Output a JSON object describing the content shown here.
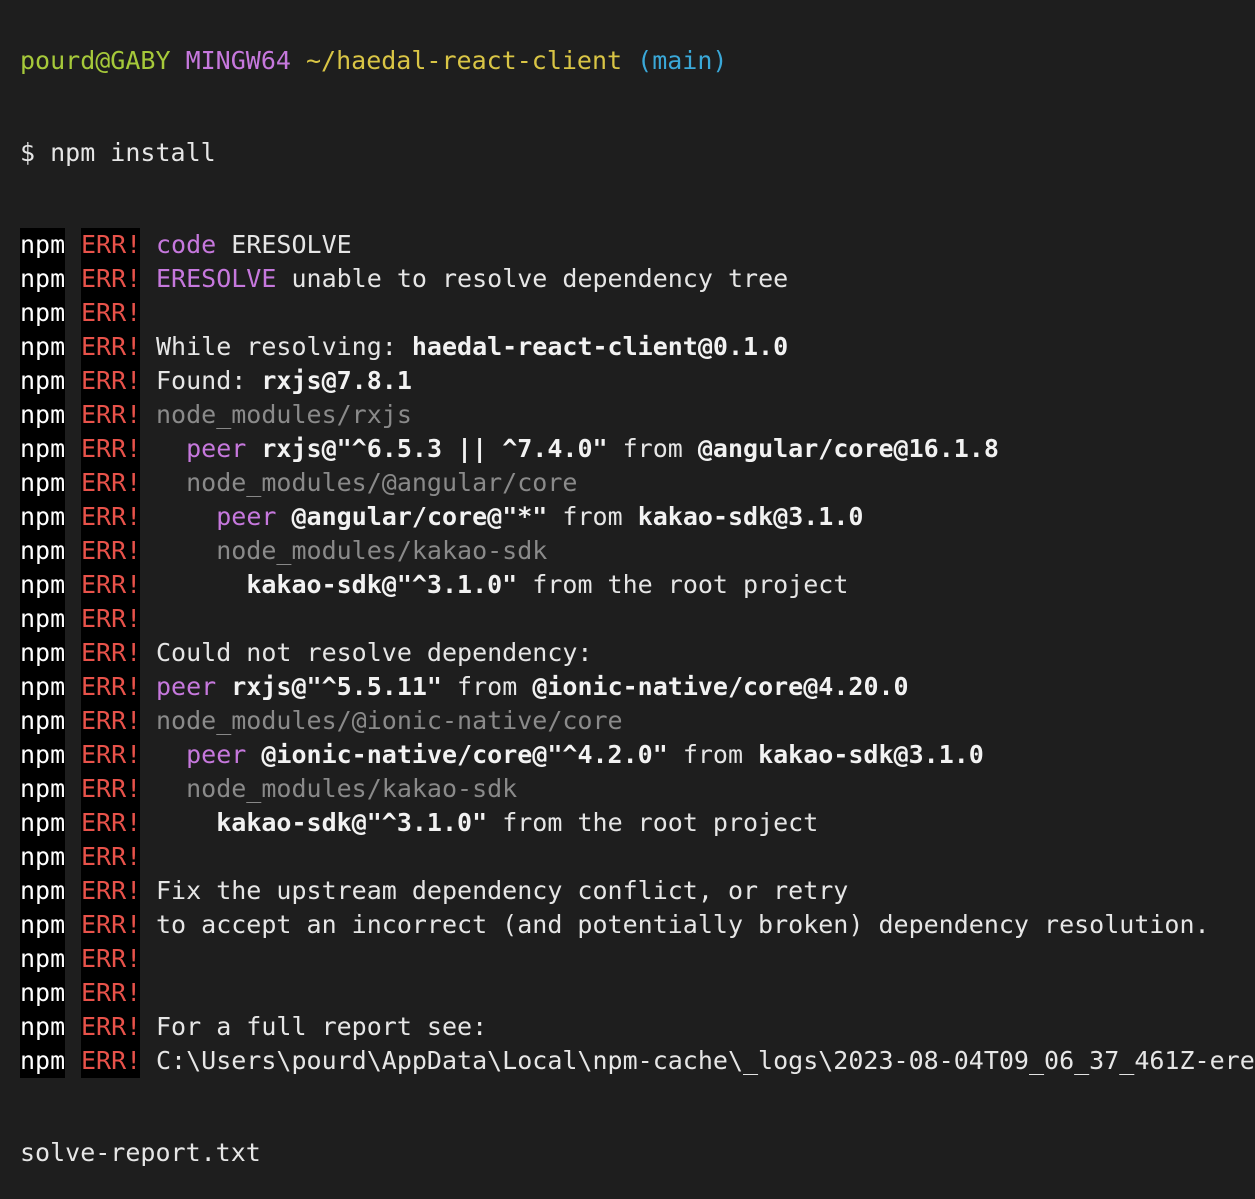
{
  "prompt": {
    "user": "pourd@GABY",
    "shell": "MINGW64",
    "path": "~/haedal-react-client",
    "branch": "(main)"
  },
  "command": "$ npm install",
  "npm_label": "npm",
  "err_label": "ERR!",
  "colors": {
    "background": "#1e1e1e",
    "err": "#e8524a",
    "magenta": "#c678dd",
    "gray": "#8a8a8a",
    "green": "#a6c93a",
    "yellow": "#d9c545",
    "cyan": "#3aa8d8"
  },
  "lines": [
    [
      {
        "t": "code",
        "s": "magenta"
      },
      {
        "t": " ERESOLVE",
        "s": "normal"
      }
    ],
    [
      {
        "t": "ERESOLVE",
        "s": "magenta"
      },
      {
        "t": " unable to resolve dependency tree",
        "s": "normal"
      }
    ],
    [],
    [
      {
        "t": "While resolving: ",
        "s": "normal"
      },
      {
        "t": "haedal-react-client@0.1.0",
        "s": "bold"
      }
    ],
    [
      {
        "t": "Found: ",
        "s": "normal"
      },
      {
        "t": "rxjs@7.8.1",
        "s": "bold"
      }
    ],
    [
      {
        "t": "node_modules/rxjs",
        "s": "gray"
      }
    ],
    [
      {
        "t": "  ",
        "s": "normal"
      },
      {
        "t": "peer",
        "s": "magenta"
      },
      {
        "t": " rxjs@\"^6.5.3 || ^7.4.0\"",
        "s": "bold"
      },
      {
        "t": " from ",
        "s": "normal"
      },
      {
        "t": "@angular/core@16.1.8",
        "s": "bold"
      }
    ],
    [
      {
        "t": "  node_modules/@angular/core",
        "s": "gray"
      }
    ],
    [
      {
        "t": "    ",
        "s": "normal"
      },
      {
        "t": "peer",
        "s": "magenta"
      },
      {
        "t": " @angular/core@\"*\"",
        "s": "bold"
      },
      {
        "t": " from ",
        "s": "normal"
      },
      {
        "t": "kakao-sdk@3.1.0",
        "s": "bold"
      }
    ],
    [
      {
        "t": "    node_modules/kakao-sdk",
        "s": "gray"
      }
    ],
    [
      {
        "t": "      ",
        "s": "normal"
      },
      {
        "t": "kakao-sdk@\"^3.1.0\"",
        "s": "bold"
      },
      {
        "t": " from the root project",
        "s": "normal"
      }
    ],
    [],
    [
      {
        "t": "Could not resolve dependency:",
        "s": "normal"
      }
    ],
    [
      {
        "t": "peer",
        "s": "magenta"
      },
      {
        "t": " rxjs@\"^5.5.11\"",
        "s": "bold"
      },
      {
        "t": " from ",
        "s": "normal"
      },
      {
        "t": "@ionic-native/core@4.20.0",
        "s": "bold"
      }
    ],
    [
      {
        "t": "node_modules/@ionic-native/core",
        "s": "gray"
      }
    ],
    [
      {
        "t": "  ",
        "s": "normal"
      },
      {
        "t": "peer",
        "s": "magenta"
      },
      {
        "t": " @ionic-native/core@\"^4.2.0\"",
        "s": "bold"
      },
      {
        "t": " from ",
        "s": "normal"
      },
      {
        "t": "kakao-sdk@3.1.0",
        "s": "bold"
      }
    ],
    [
      {
        "t": "  node_modules/kakao-sdk",
        "s": "gray"
      }
    ],
    [
      {
        "t": "    ",
        "s": "normal"
      },
      {
        "t": "kakao-sdk@\"^3.1.0\"",
        "s": "bold"
      },
      {
        "t": " from the root project",
        "s": "normal"
      }
    ],
    [],
    [
      {
        "t": "Fix the upstream dependency conflict, or retry",
        "s": "normal"
      }
    ],
    [
      {
        "t": "to accept an incorrect (and potentially broken) dependency resolution.",
        "s": "normal"
      }
    ],
    [],
    [],
    [
      {
        "t": "For a full report see:",
        "s": "normal"
      }
    ],
    [
      {
        "t": "C:\\Users\\pourd\\AppData\\Local\\npm-cache\\_logs\\2023-08-04T09_06_37_461Z-ere",
        "s": "normal"
      }
    ]
  ],
  "wrapped_tail": "solve-report.txt"
}
